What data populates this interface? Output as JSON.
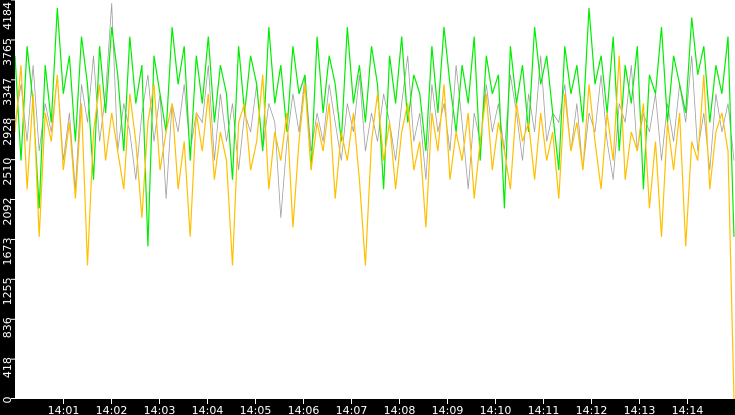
{
  "chart_data": {
    "type": "line",
    "title": "",
    "xlabel": "",
    "ylabel": "",
    "ylim": [
      0,
      4184
    ],
    "xlim_minutes": [
      0.0,
      15.0
    ],
    "grid": false,
    "y_ticks": [
      "0",
      "418",
      "836",
      "1255",
      "1673",
      "2092",
      "2510",
      "2928",
      "3347",
      "3765",
      "4184"
    ],
    "x_ticks": [
      "14:01",
      "14:02",
      "14:03",
      "14:04",
      "14:05",
      "14:06",
      "14:07",
      "14:08",
      "14:09",
      "14:10",
      "14:11",
      "14:12",
      "14:13",
      "14:14"
    ],
    "colors": {
      "background": "#ffffff",
      "axis": "#000000",
      "green": "#00ee00",
      "orange": "#ffc000",
      "gray": "#a0a0a0"
    },
    "series": [
      {
        "name": "gray",
        "color": "#a0a0a0",
        "values": [
          2900,
          3300,
          2700,
          3500,
          2600,
          3100,
          2800,
          3400,
          2500,
          3000,
          2200,
          3300,
          2900,
          3600,
          2700,
          3200,
          4150,
          2600,
          3100,
          2800,
          2300,
          3000,
          3400,
          2700,
          3200,
          2100,
          3100,
          2800,
          3300,
          2600,
          3000,
          2900,
          3500,
          2500,
          3200,
          2700,
          3100,
          2400,
          3000,
          2800,
          3300,
          2600,
          3100,
          2900,
          1900,
          2700,
          3200,
          2800,
          3400,
          2600,
          3000,
          2700,
          3300,
          2900,
          2500,
          3100,
          2800,
          3400,
          2600,
          3000,
          2700,
          3200,
          2900,
          2500,
          3100,
          3600,
          2700,
          3000,
          2300,
          3300,
          2800,
          3100,
          2600,
          3500,
          2900,
          2200,
          3000,
          2700,
          3300,
          2800,
          3100,
          2600,
          3400,
          3000,
          2500,
          3200,
          2800,
          3600,
          2700,
          3000,
          2900,
          3300,
          2600,
          3100,
          2400,
          3000,
          2800,
          3400,
          2700,
          2300,
          3100,
          2900,
          3500,
          2600,
          3000,
          2800,
          3200,
          2500,
          3100,
          2700,
          3300,
          2900,
          3600,
          2600,
          3000,
          2400,
          3200,
          2800,
          3100,
          2500
        ]
      },
      {
        "name": "green",
        "color": "#00ee00",
        "values": [
          3600,
          2500,
          3700,
          3100,
          2000,
          3500,
          2900,
          4100,
          3200,
          3600,
          2700,
          3800,
          3300,
          2300,
          3700,
          3000,
          3900,
          3400,
          2600,
          3800,
          3100,
          3500,
          1600,
          3600,
          3200,
          2800,
          3900,
          3300,
          3700,
          2500,
          3600,
          3100,
          3800,
          2900,
          3500,
          3200,
          2300,
          3700,
          3000,
          3600,
          3300,
          2600,
          3900,
          3100,
          3500,
          2800,
          3700,
          3200,
          3400,
          2400,
          3800,
          3000,
          3600,
          3300,
          2700,
          3900,
          3100,
          3500,
          2900,
          3700,
          3300,
          2200,
          3600,
          3100,
          3800,
          2900,
          3400,
          3200,
          2600,
          3700,
          3000,
          3900,
          3300,
          2800,
          3500,
          3100,
          3800,
          2500,
          3600,
          3200,
          3400,
          2000,
          3700,
          3100,
          3500,
          2800,
          3900,
          3300,
          3600,
          3000,
          2400,
          3700,
          3200,
          3500,
          2900,
          4100,
          3300,
          3600,
          3000,
          3800,
          2600,
          3500,
          3100,
          3700,
          2200,
          3400,
          3200,
          3900,
          2900,
          3600,
          3300,
          3000,
          4000,
          3400,
          3700,
          2900,
          3500,
          3200,
          3800,
          1700
        ]
      },
      {
        "name": "orange",
        "color": "#ffc000",
        "values": [
          2800,
          3500,
          2200,
          3200,
          1700,
          3000,
          2700,
          3400,
          2400,
          2900,
          2100,
          3100,
          1400,
          2800,
          3300,
          2500,
          3000,
          2600,
          2200,
          3200,
          2700,
          1900,
          2900,
          3300,
          2400,
          2800,
          3100,
          2200,
          2700,
          1700,
          3000,
          2600,
          3200,
          2300,
          2800,
          2500,
          1400,
          2900,
          3100,
          2400,
          2700,
          3400,
          2200,
          2800,
          2500,
          3000,
          1800,
          2700,
          3300,
          2400,
          2900,
          2600,
          3100,
          2100,
          2800,
          2500,
          3000,
          2300,
          1400,
          2700,
          3200,
          2500,
          2900,
          2200,
          2800,
          3100,
          2400,
          2700,
          1800,
          3000,
          2600,
          3300,
          2300,
          2800,
          2500,
          3000,
          2100,
          2700,
          3200,
          2400,
          2900,
          2600,
          2200,
          3100,
          2700,
          2900,
          2300,
          3000,
          2500,
          2800,
          2100,
          3200,
          2600,
          2900,
          2400,
          3300,
          2700,
          2200,
          3000,
          2500,
          3600,
          2300,
          2800,
          2600,
          3100,
          2000,
          2700,
          1700,
          2900,
          2400,
          3000,
          1600,
          2700,
          2500,
          3400,
          2200,
          2800,
          3000,
          2600,
          0
        ]
      }
    ]
  }
}
